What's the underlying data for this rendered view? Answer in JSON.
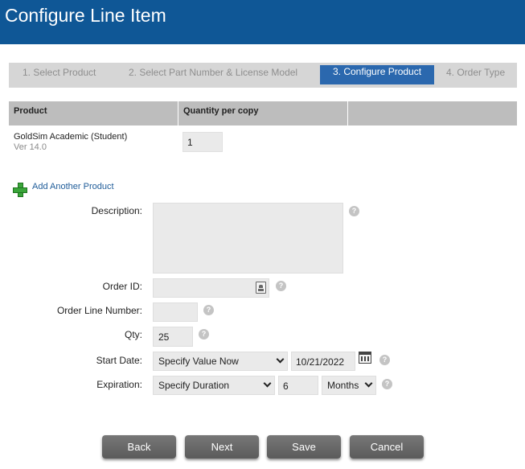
{
  "header": {
    "title": "Configure Line Item"
  },
  "steps": [
    {
      "label": "1. Select Product",
      "active": false
    },
    {
      "label": "2. Select Part Number & License Model",
      "active": false
    },
    {
      "label": "3. Configure Product",
      "active": true
    },
    {
      "label": "4. Order Type",
      "active": false
    }
  ],
  "grid": {
    "columns": [
      "Product",
      "Quantity per copy",
      ""
    ],
    "rows": [
      {
        "product": "GoldSim Academic (Student)",
        "version": "Ver 14.0",
        "quantity_per_copy": "1"
      }
    ]
  },
  "add_product": {
    "label": "Add Another Product",
    "icon": "plus-icon"
  },
  "form": {
    "description": {
      "label": "Description:",
      "value": ""
    },
    "order_id": {
      "label": "Order ID:",
      "value": ""
    },
    "order_line_number": {
      "label": "Order Line Number:",
      "value": ""
    },
    "qty": {
      "label": "Qty:",
      "value": "25"
    },
    "start_date": {
      "label": "Start Date:",
      "mode": "Specify Value Now",
      "date": "10/21/2022"
    },
    "expiration": {
      "label": "Expiration:",
      "mode": "Specify Duration",
      "amount": "6",
      "unit": "Months"
    },
    "help_glyph": "?"
  },
  "buttons": {
    "back": "Back",
    "next": "Next",
    "save": "Save",
    "cancel": "Cancel"
  },
  "colors": {
    "header": "#0f5796",
    "active_step": "#2b68ae",
    "button": "#666666"
  }
}
